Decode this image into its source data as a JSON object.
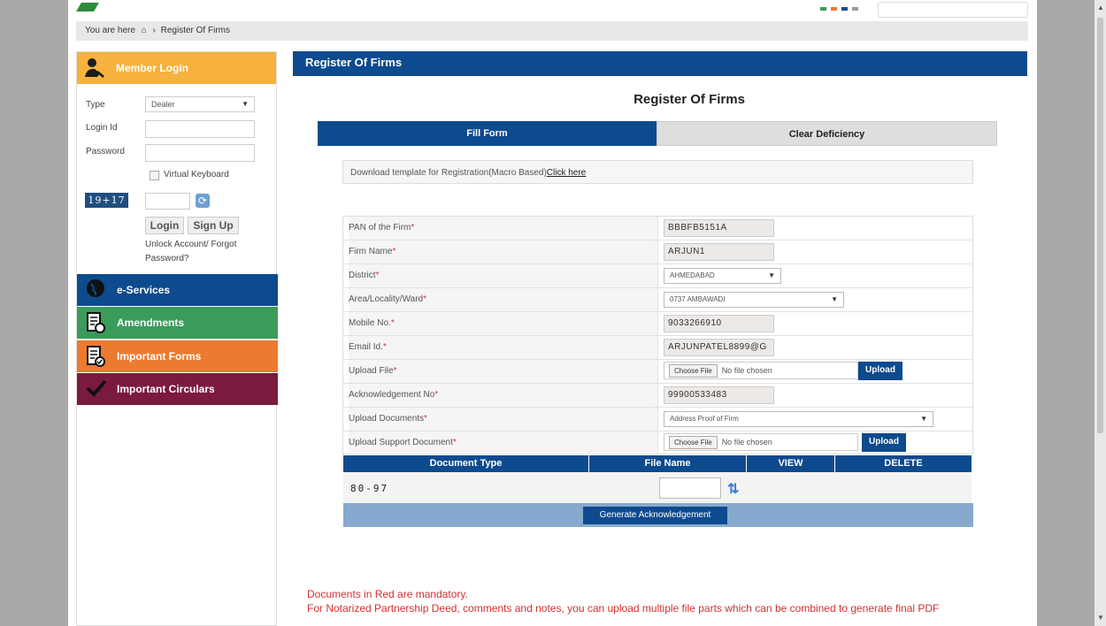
{
  "breadcrumb": {
    "prefix": "You are here",
    "current": "Register Of Firms"
  },
  "member_login": {
    "title": "Member Login",
    "type_label": "Type",
    "type_value": "Dealer",
    "login_id_label": "Login Id",
    "password_label": "Password",
    "virtual_keyboard_label": "Virtual Keyboard",
    "captcha_text": "19+17",
    "login_button": "Login",
    "signup_button": "Sign Up",
    "unlock_link": "Unlock Account/ Forgot Password?"
  },
  "sidebar_menu": [
    {
      "label": "e-Services",
      "color": "#0d4a8e"
    },
    {
      "label": "Amendments",
      "color": "#3a9b5b"
    },
    {
      "label": "Important Forms",
      "color": "#ec7a2f"
    },
    {
      "label": "Important Circulars",
      "color": "#7b1a3f"
    }
  ],
  "main": {
    "header": "Register Of Firms",
    "title": "Register Of Firms",
    "tabs": [
      {
        "label": "Fill Form",
        "active": true
      },
      {
        "label": "Clear Deficiency",
        "active": false
      }
    ],
    "template_text": "Download template for Registration(Macro Based)",
    "template_link": "Click here"
  },
  "form": {
    "pan_label": "PAN of the Firm",
    "pan_value": "BBBFB5151A",
    "firm_label": "Firm Name",
    "firm_value": "ARJUN1",
    "district_label": "District",
    "district_value": "AHMEDABAD",
    "area_label": "Area/Locality/Ward",
    "area_value": "0737 AMBAWADI",
    "mobile_label": "Mobile No.",
    "mobile_value": "9033266910",
    "email_label": "Email Id.",
    "email_value": "ARJUNPATEL8899@G",
    "upload_file_label": "Upload File",
    "ack_label": "Acknowledgement No",
    "ack_value": "99900533483",
    "upload_docs_label": "Upload Documents",
    "upload_docs_value": "Address Proof of Firm",
    "upload_support_label": "Upload Support Document",
    "choose_file": "Choose File",
    "no_file": "No file chosen",
    "upload_button": "Upload",
    "required_mark": "*"
  },
  "doc_table": {
    "headers": [
      "Document Type",
      "File Name",
      "VIEW",
      "DELETE"
    ]
  },
  "captcha2": {
    "text": "80-97"
  },
  "generate_button": "Generate Acknowledgement",
  "notes": [
    "Documents in Red are mandatory.",
    "For Notarized Partnership Deed, comments and notes, you can upload multiple file parts which can be combined to generate final PDF"
  ]
}
